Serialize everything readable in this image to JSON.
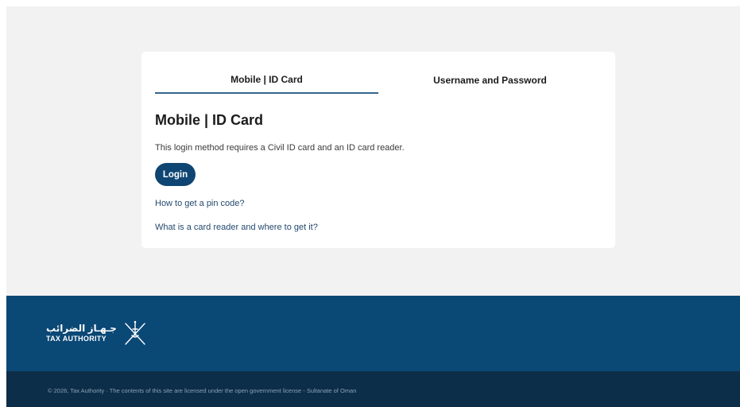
{
  "tabs": [
    {
      "label": "Mobile | ID Card",
      "active": true
    },
    {
      "label": "Username and Password",
      "active": false
    }
  ],
  "card": {
    "heading": "Mobile | ID Card",
    "description": "This login method requires a Civil ID card and an ID card reader.",
    "login_label": "Login",
    "links": {
      "pin": "How to get a pin code?",
      "reader": "What is a card reader and where to get it?"
    }
  },
  "footer": {
    "logo_arabic": "جـهـاز الضرائب",
    "logo_english": "TAX AUTHORITY",
    "emblem_icon": "oman-khanjar-emblem-icon",
    "copyright": "© 2026, Tax Authority · The contents of this site are licensed under the open government license - Sultanate of Oman"
  },
  "colors": {
    "primary": "#0f4572",
    "tab_underline": "#35658d",
    "footer_top": "#0a4876",
    "footer_bottom": "#0d2e49",
    "background": "#f2f2f2"
  }
}
